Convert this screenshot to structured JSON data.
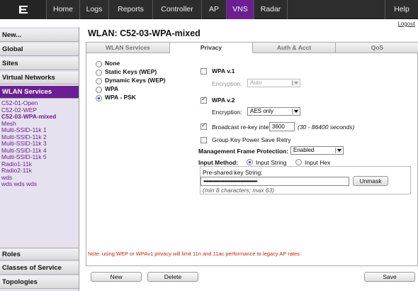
{
  "topnav": {
    "items": [
      {
        "label": "Home"
      },
      {
        "label": "Logs"
      },
      {
        "label": "Reports"
      },
      {
        "label": "Controller"
      },
      {
        "label": "AP"
      },
      {
        "label": "VNS"
      },
      {
        "label": "Radar"
      },
      {
        "label": "Help"
      }
    ],
    "active": "VNS",
    "logout": "Logout",
    "accent": "#6b1f93"
  },
  "sidebar": {
    "sections_top": [
      {
        "label": "New..."
      },
      {
        "label": "Global"
      },
      {
        "label": "Sites"
      },
      {
        "label": "Virtual Networks"
      },
      {
        "label": "WLAN Services"
      }
    ],
    "wlan_list": [
      "C52-01-Open",
      "C52-02-WEP",
      "C52-03-WPA-mixed",
      "Mesh",
      "Multi-SSID-11k 1",
      "Multi-SSID-11k 2",
      "Multi-SSID-11k 3",
      "Multi-SSID-11k 4",
      "Multi-SSID-11k 5",
      "Radio1-11k",
      "Radio2-11k",
      "wds",
      "wds wds wds"
    ],
    "sections_bottom": [
      {
        "label": "Roles"
      },
      {
        "label": "Classes of Service"
      },
      {
        "label": "Topologies"
      }
    ]
  },
  "page": {
    "title": "WLAN: C52-03-WPA-mixed"
  },
  "tabs": [
    {
      "label": "WLAN Services"
    },
    {
      "label": "Privacy"
    },
    {
      "label": "Auth & Acct"
    },
    {
      "label": "QoS"
    }
  ],
  "privacy": {
    "modes": [
      "None",
      "Static Keys (WEP)",
      "Dynamic Keys (WEP)",
      "WPA",
      "WPA - PSK"
    ],
    "selected_mode": "WPA - PSK",
    "wpa_v1": {
      "label": "WPA v.1",
      "checked": false,
      "encryption_label": "Encryption:",
      "encryption_value": "Auto"
    },
    "wpa_v2": {
      "label": "WPA v.2",
      "checked": true,
      "encryption_label": "Encryption:",
      "encryption_value": "AES only"
    },
    "rekey": {
      "label": "Broadcast re-key interval:",
      "checked": true,
      "value": "3600",
      "hint": "(30 - 86400 seconds)"
    },
    "group_key": {
      "label": "Group Key Power Save Retry",
      "checked": false
    },
    "mfp": {
      "label": "Management Frame Protection:",
      "value": "Enabled"
    },
    "input_method": {
      "label": "Input Method:",
      "options": [
        "Input String",
        "Input Hex"
      ],
      "selected": "Input String"
    },
    "psk": {
      "label": "Pre-shared key String:",
      "value": "••••••••••••••••••••••••••••••••••••••••••",
      "unmask": "Unmask",
      "hint": "(min 8 characters; max 63)"
    }
  },
  "note": "Note: using WEP or WPAv1 privacy will limit 11n and 11ac performance to legacy AP rates.",
  "buttons": {
    "new": "New",
    "delete": "Delete",
    "save": "Save"
  }
}
